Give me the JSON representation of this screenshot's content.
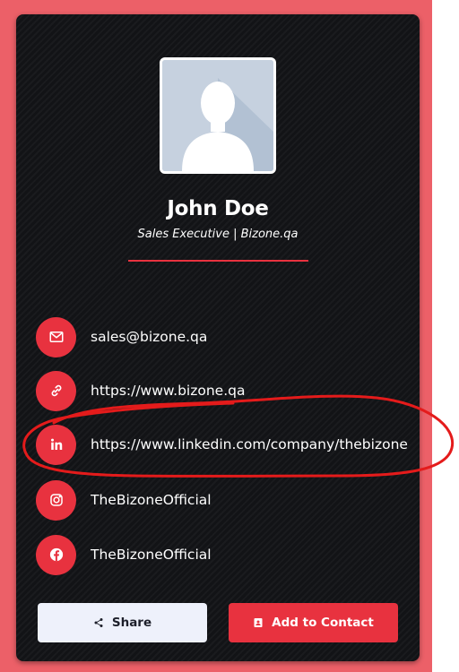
{
  "profile": {
    "name": "John Doe",
    "title": "Sales Executive | Bizone.qa"
  },
  "contacts": [
    {
      "icon": "mail-icon",
      "label": "sales@bizone.qa"
    },
    {
      "icon": "link-icon",
      "label": "https://www.bizone.qa"
    },
    {
      "icon": "linkedin-icon",
      "label": "https://www.linkedin.com/company/thebizone"
    },
    {
      "icon": "instagram-icon",
      "label": "TheBizoneOfficial"
    },
    {
      "icon": "facebook-icon",
      "label": "TheBizoneOfficial"
    }
  ],
  "actions": {
    "share_label": "Share",
    "add_contact_label": "Add to Contact"
  },
  "colors": {
    "accent": "#e8323f",
    "card_background": "#121316",
    "page_background": "#ec6068",
    "share_button_background": "#eef1fb"
  }
}
